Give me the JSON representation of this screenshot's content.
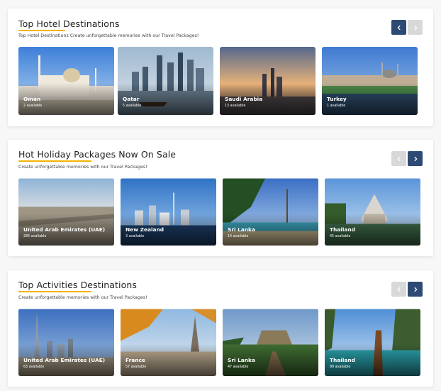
{
  "sections": [
    {
      "title": "Top Hotel Destinations",
      "subtitle": "Top Hotel Destinations Create unforgettable memories with our Travel Packages!",
      "prev_enabled": true,
      "next_enabled": false,
      "cards": [
        {
          "name": "Oman",
          "count": "2 available"
        },
        {
          "name": "Qatar",
          "count": "5 available"
        },
        {
          "name": "Saudi Arabia",
          "count": "13 available"
        },
        {
          "name": "Turkey",
          "count": "1 available"
        }
      ]
    },
    {
      "title": "Hot Holiday Packages Now On Sale",
      "subtitle": "Create unforgettable memories with our Travel Packages!",
      "prev_enabled": false,
      "next_enabled": true,
      "cards": [
        {
          "name": "United Arab Emirates (UAE)",
          "count": "285 available"
        },
        {
          "name": "New Zealand",
          "count": "3 available"
        },
        {
          "name": "Sri Lanka",
          "count": "14 available"
        },
        {
          "name": "Thailand",
          "count": "45 available"
        }
      ]
    },
    {
      "title": "Top Activities Destinations",
      "subtitle": "Create unforgettable memories with our Travel Packages!",
      "prev_enabled": false,
      "next_enabled": true,
      "cards": [
        {
          "name": "United Arab Emirates (UAE)",
          "count": "63 available"
        },
        {
          "name": "France",
          "count": "57 available"
        },
        {
          "name": "Sri Lanka",
          "count": "47 available"
        },
        {
          "name": "Thailand",
          "count": "89 available"
        }
      ]
    }
  ],
  "icons": {
    "prev": "chevron-left-icon",
    "next": "chevron-right-icon"
  },
  "colors": {
    "accent_underline": "#f2b300",
    "nav_active": "#2d4a75",
    "nav_disabled": "#d8d8d8"
  }
}
